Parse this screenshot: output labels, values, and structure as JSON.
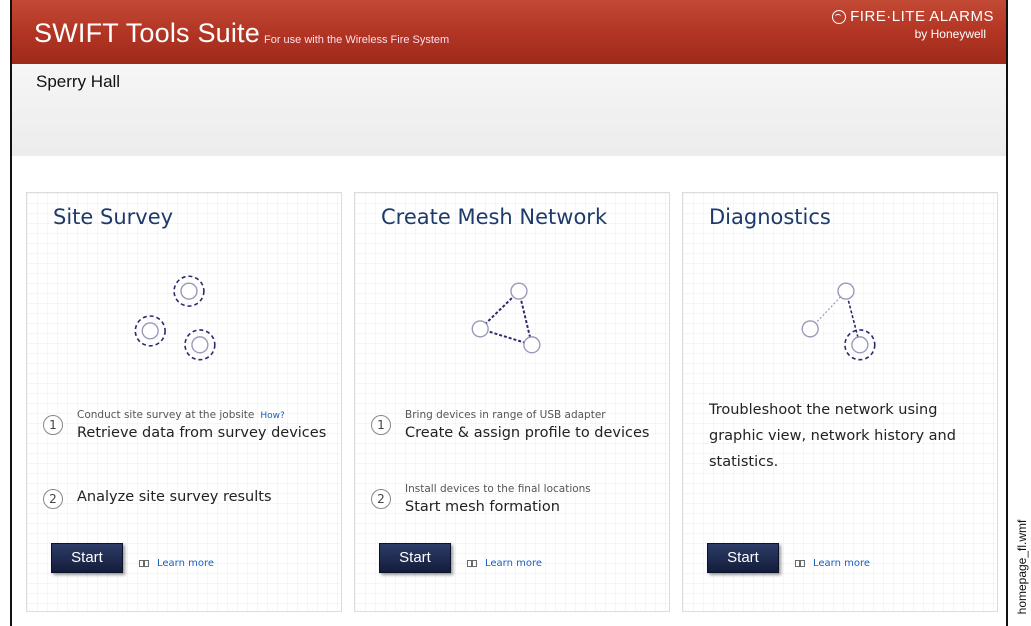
{
  "header": {
    "title": "SWIFT Tools Suite",
    "subtitle": "For use with the Wireless Fire System",
    "brand_top": "FIRE·LITE ALARMS",
    "brand_bottom": "by Honeywell",
    "accent_color": "#b33524"
  },
  "site": {
    "name": "Sperry Hall"
  },
  "cards": {
    "site_survey": {
      "title": "Site Survey",
      "step1_num": "1",
      "step1_small": "Conduct site survey at the jobsite",
      "step1_link": "How?",
      "step1_big": "Retrieve data from survey devices",
      "step2_num": "2",
      "step2_big": "Analyze site survey results",
      "start_label": "Start",
      "learn_label": "Learn more"
    },
    "mesh": {
      "title": "Create Mesh Network",
      "step1_num": "1",
      "step1_small": "Bring devices in range of USB adapter",
      "step1_big": "Create & assign profile to devices",
      "step2_num": "2",
      "step2_small": "Install devices to the final locations",
      "step2_big": "Start mesh formation",
      "start_label": "Start",
      "learn_label": "Learn more"
    },
    "diagnostics": {
      "title": "Diagnostics",
      "description": "Troubleshoot the network using graphic view, network history and statistics.",
      "start_label": "Start",
      "learn_label": "Learn more"
    }
  },
  "caption": "homepage_fl.wmf",
  "colors": {
    "title_blue": "#1d3a6b",
    "button_navy": "#1c2748",
    "link_blue": "#1a5fc0"
  }
}
